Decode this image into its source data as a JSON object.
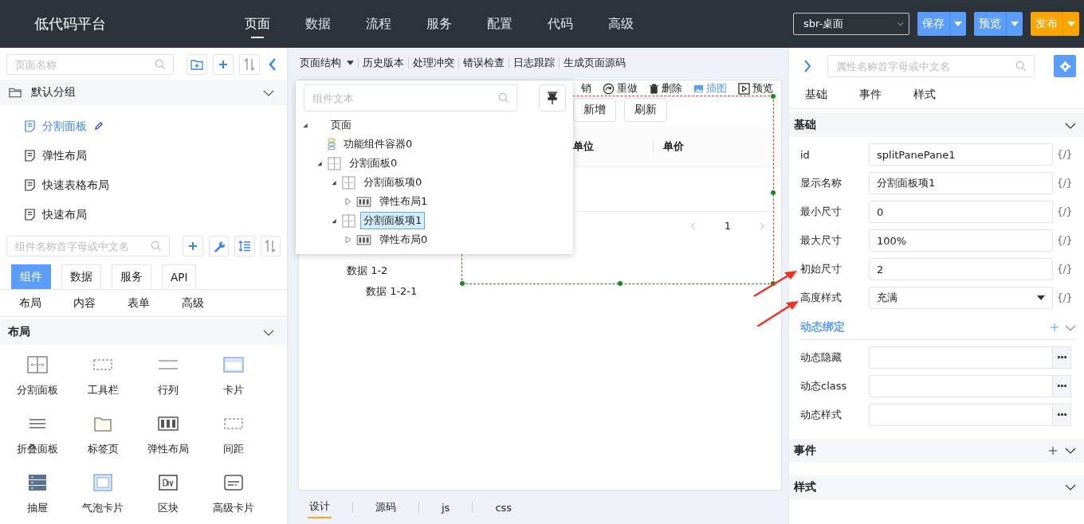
{
  "header": {
    "logo": "低代码平台",
    "nav": [
      {
        "label": "页面",
        "selected": true
      },
      {
        "label": "数据",
        "selected": false
      },
      {
        "label": "流程",
        "selected": false
      },
      {
        "label": "服务",
        "selected": false
      },
      {
        "label": "配置",
        "selected": false
      },
      {
        "label": "代码",
        "selected": false
      },
      {
        "label": "高级",
        "selected": false
      }
    ],
    "env_select": {
      "value": "sbr-桌面"
    },
    "buttons": [
      {
        "label": "保存",
        "kind": "primary"
      },
      {
        "label": "预览",
        "kind": "primary"
      },
      {
        "label": "发布",
        "kind": "warning"
      }
    ]
  },
  "left_panel": {
    "page_search": {
      "placeholder": "页面名称"
    },
    "page_group": {
      "label": "默认分组",
      "expanded": true
    },
    "pages": [
      {
        "label": "分割面板",
        "selected": true
      },
      {
        "label": "弹性布局",
        "selected": false
      },
      {
        "label": "快速表格布局",
        "selected": false
      },
      {
        "label": "快速布局",
        "selected": false
      }
    ],
    "component_search": {
      "placeholder": "组件名称首字母或中文名"
    },
    "source_tabs": [
      {
        "label": "组件",
        "selected": true
      },
      {
        "label": "数据",
        "selected": false
      },
      {
        "label": "服务",
        "selected": false
      },
      {
        "label": "API",
        "selected": false
      }
    ],
    "category_tabs": [
      {
        "label": "布局"
      },
      {
        "label": "内容"
      },
      {
        "label": "表单"
      },
      {
        "label": "高级"
      }
    ],
    "section": {
      "title": "布局",
      "expanded": true
    },
    "components": [
      {
        "label": "分割面板",
        "kind": "split"
      },
      {
        "label": "工具栏",
        "kind": "dashed"
      },
      {
        "label": "行列",
        "kind": "rows"
      },
      {
        "label": "卡片",
        "kind": "card"
      },
      {
        "label": "折叠面板",
        "kind": "lines"
      },
      {
        "label": "标签页",
        "kind": "folder"
      },
      {
        "label": "弹性布局",
        "kind": "flex"
      },
      {
        "label": "间距",
        "kind": "dashed"
      },
      {
        "label": "抽屉",
        "kind": "drawer"
      },
      {
        "label": "气泡卡片",
        "kind": "frame"
      },
      {
        "label": "区块",
        "kind": "div"
      },
      {
        "label": "高级卡片",
        "kind": "advcard"
      }
    ]
  },
  "center": {
    "toolbar": [
      {
        "label": "页面结构",
        "dropdown": true
      },
      {
        "label": "历史版本",
        "dropdown": false
      },
      {
        "label": "处理冲突",
        "dropdown": false
      },
      {
        "label": "错误检查",
        "dropdown": false
      },
      {
        "label": "日志跟踪",
        "dropdown": false
      },
      {
        "label": "生成页面源码",
        "dropdown": false
      }
    ],
    "structure_popup": {
      "search": {
        "placeholder": "组件文本"
      },
      "tree": [
        {
          "label": "页面",
          "kind": "page",
          "expanded": true,
          "selected": false,
          "children": [
            {
              "label": "功能组件容器0",
              "kind": "container",
              "selected": false
            },
            {
              "label": "分割面板0",
              "kind": "split",
              "expanded": true,
              "selected": false,
              "children": [
                {
                  "label": "分割面板项0",
                  "kind": "split",
                  "expanded": true,
                  "selected": false,
                  "children": [
                    {
                      "label": "弹性布局1",
                      "kind": "flex",
                      "expanded": false,
                      "selected": false
                    }
                  ]
                },
                {
                  "label": "分割面板项1",
                  "kind": "split",
                  "expanded": true,
                  "selected": true,
                  "children": [
                    {
                      "label": "弹性布局0",
                      "kind": "flex",
                      "expanded": false,
                      "selected": false
                    }
                  ]
                }
              ]
            }
          ]
        }
      ]
    },
    "canvas": {
      "actions": [
        {
          "label": "销",
          "kind": "undo"
        },
        {
          "label": "重做",
          "kind": "redo"
        },
        {
          "label": "删除",
          "kind": "delete"
        },
        {
          "label": "插图",
          "kind": "image"
        },
        {
          "label": "预览",
          "kind": "preview"
        }
      ],
      "buttons": [
        "新增",
        "刷新"
      ],
      "columns": [
        "单位",
        "单价"
      ],
      "page_number": "1",
      "data_rows": [
        {
          "label": "数据 1-2",
          "children": [
            {
              "label": "数据 1-2-1"
            }
          ]
        }
      ]
    },
    "bottom_tabs": [
      {
        "label": "设计",
        "selected": true
      },
      {
        "label": "源码",
        "selected": false
      },
      {
        "label": "js",
        "selected": false
      },
      {
        "label": "css",
        "selected": false
      }
    ]
  },
  "right_panel": {
    "search": {
      "placeholder": "属性名称首字母或中文名"
    },
    "tabs": [
      {
        "label": "基础"
      },
      {
        "label": "事件"
      },
      {
        "label": "样式"
      }
    ],
    "basic": {
      "title": "基础",
      "expanded": true,
      "fields": [
        {
          "label": "id",
          "value": "splitPanePane1",
          "kind": "text",
          "expression_button": "{/}"
        },
        {
          "label": "显示名称",
          "value": "分割面板项1",
          "kind": "text",
          "expression_button": "{/}"
        },
        {
          "label": "最小尺寸",
          "value": "0",
          "kind": "text",
          "expression_button": "{/}"
        },
        {
          "label": "最大尺寸",
          "value": "100%",
          "kind": "text",
          "expression_button": "{/}"
        },
        {
          "label": "初始尺寸",
          "value": "2",
          "kind": "text",
          "expression_button": "{/}"
        },
        {
          "label": "高度样式",
          "value": "充满",
          "kind": "select",
          "expression_button": "{/}"
        }
      ],
      "binding": {
        "title": "动态绑定",
        "expanded": true,
        "fields": [
          {
            "label": "动态隐藏"
          },
          {
            "label": "动态class"
          },
          {
            "label": "动态样式"
          }
        ]
      }
    },
    "sections": [
      {
        "title": "事件",
        "addable": true
      },
      {
        "title": "样式",
        "addable": false
      }
    ]
  }
}
